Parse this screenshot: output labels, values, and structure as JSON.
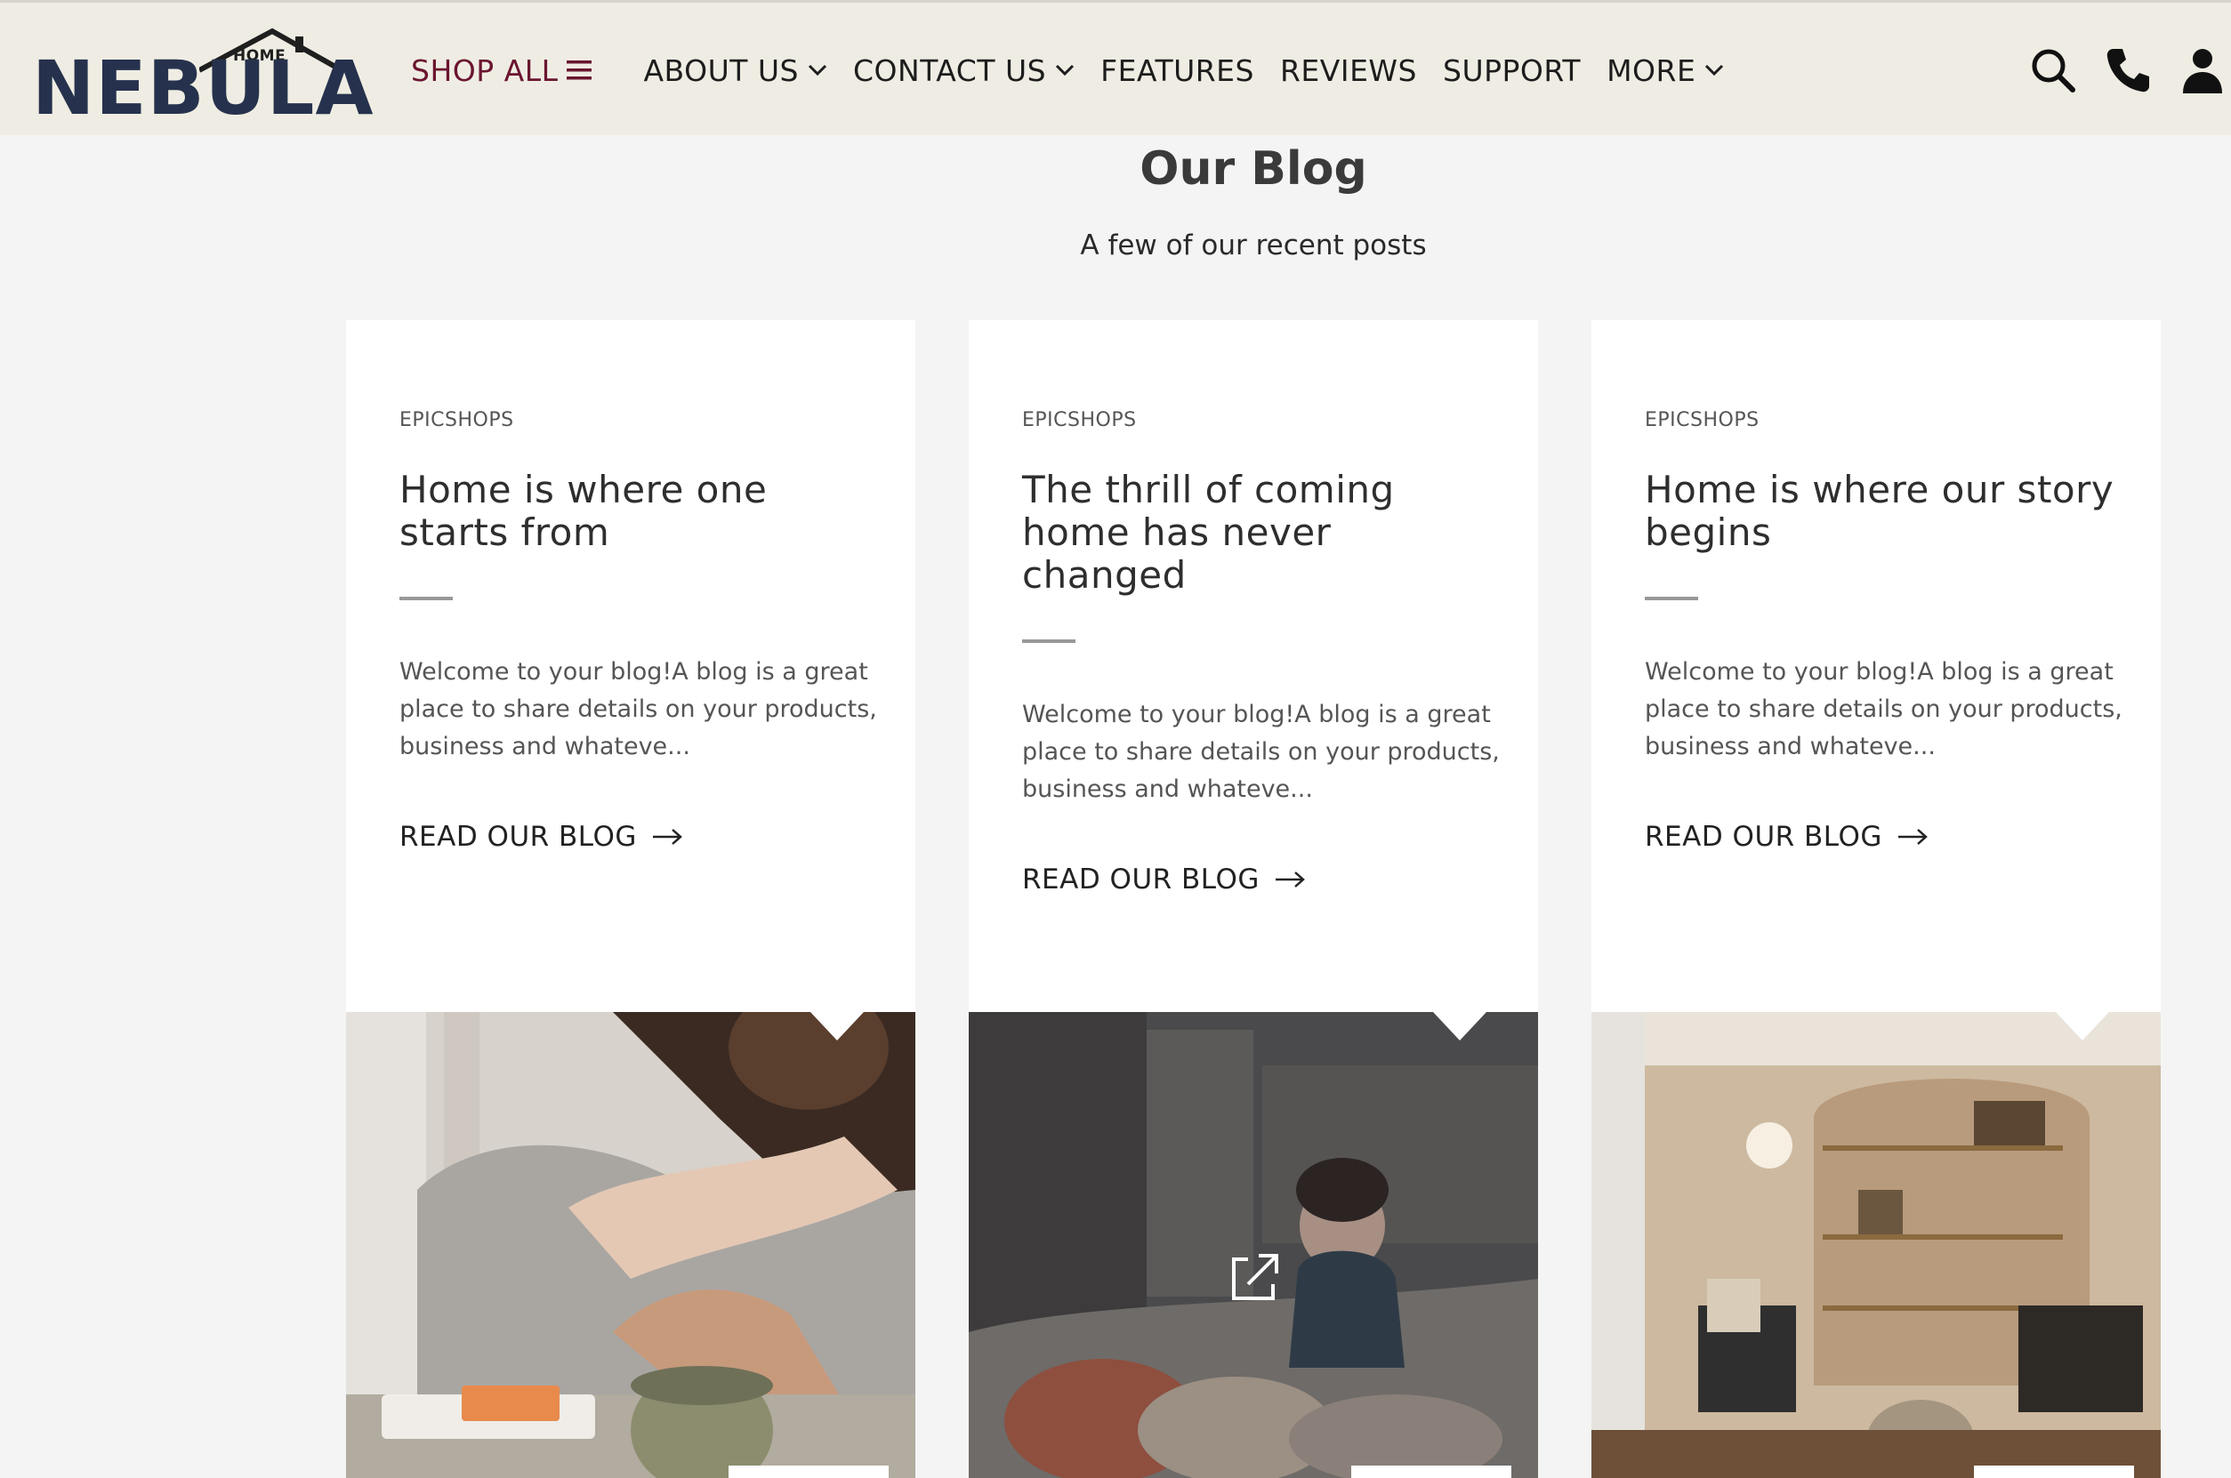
{
  "brand": {
    "name": "NEBULA",
    "tagline": "HOME",
    "color": "#26324d"
  },
  "nav": {
    "shop_all": "SHOP ALL",
    "items": [
      {
        "label": "ABOUT US",
        "dropdown": true
      },
      {
        "label": "CONTACT US",
        "dropdown": true
      },
      {
        "label": "FEATURES",
        "dropdown": false
      },
      {
        "label": "REVIEWS",
        "dropdown": false
      },
      {
        "label": "SUPPORT",
        "dropdown": false
      },
      {
        "label": "MORE",
        "dropdown": true
      }
    ],
    "icons": [
      "search-icon",
      "phone-icon",
      "user-icon"
    ],
    "shop_color": "#6a1530"
  },
  "blog": {
    "title": "Our Blog",
    "subtitle": "A few of our recent posts",
    "cards": [
      {
        "author": "EPICSHOPS",
        "title": "Home is where one starts from",
        "excerpt": "Welcome to your blog!A blog is a great place to share details on your products, business and whateve...",
        "link": "READ OUR BLOG",
        "image": "couple-embrace-photo"
      },
      {
        "author": "EPICSHOPS",
        "title": "The thrill of coming home has never changed",
        "excerpt": "Welcome to your blog!A blog is a great place to share details on your products, business and whateve...",
        "link": "READ OUR BLOG",
        "image": "child-with-toys-photo"
      },
      {
        "author": "EPICSHOPS",
        "title": "Home is where our story begins",
        "excerpt": "Welcome to your blog!A blog is a great place to share details on your products, business and whateve...",
        "link": "READ OUR BLOG",
        "image": "living-room-interior-photo"
      }
    ]
  }
}
